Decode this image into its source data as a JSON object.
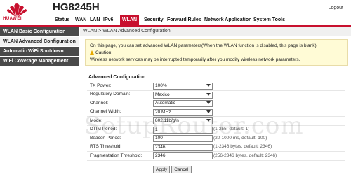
{
  "header": {
    "brand": "HUAWEI",
    "model": "HG8245H",
    "logout": "Logout"
  },
  "nav": [
    "Status",
    "WAN",
    "LAN",
    "IPv6",
    "WLAN",
    "Security",
    "Forward Rules",
    "Network Application",
    "System Tools"
  ],
  "nav_active": "WLAN",
  "sidebar": {
    "items": [
      {
        "label": "WLAN Basic Configuration"
      },
      {
        "label": "WLAN Advanced Configuration"
      },
      {
        "label": "Automatic WiFi Shutdown"
      },
      {
        "label": "WiFi Coverage Management"
      }
    ]
  },
  "breadcrumb": "WLAN > WLAN Advanced Configuration",
  "info": {
    "line1": "On this page, you can set advanced WLAN parameters(When the WLAN function is disabled, this page is blank).",
    "caution": "Caution:",
    "line3": "Wireless network services may be interrupted temporarily after you modify wireless network parameters."
  },
  "section_title": "Advanced Configuration",
  "fields": [
    {
      "label": "TX Power:",
      "value": "100%",
      "hint": ""
    },
    {
      "label": "Regulatory Domain:",
      "value": "Mexico",
      "hint": ""
    },
    {
      "label": "Channel:",
      "value": "Automatic",
      "hint": ""
    },
    {
      "label": "Channel Width:",
      "value": "20 MHz",
      "hint": ""
    },
    {
      "label": "Mode:",
      "value": "802.11b/g/n",
      "hint": ""
    },
    {
      "label": "DTIM Period:",
      "value": "1",
      "hint": "(1-255, default: 1)"
    },
    {
      "label": "Beacon Period:",
      "value": "100",
      "hint": "(20-1000 ms, default: 100)"
    },
    {
      "label": "RTS Threshold:",
      "value": "2346",
      "hint": "(1-2346 bytes, default: 2346)"
    },
    {
      "label": "Fragmentation Threshold:",
      "value": "2346",
      "hint": "(256-2346 bytes, default: 2346)"
    }
  ],
  "buttons": {
    "apply": "Apply",
    "cancel": "Cancel"
  },
  "watermark": "SetupRouter.com",
  "colors": {
    "accent": "#c8102e",
    "sidebar_bg": "#4a4a4a",
    "info_bg": "#fffbd6"
  }
}
